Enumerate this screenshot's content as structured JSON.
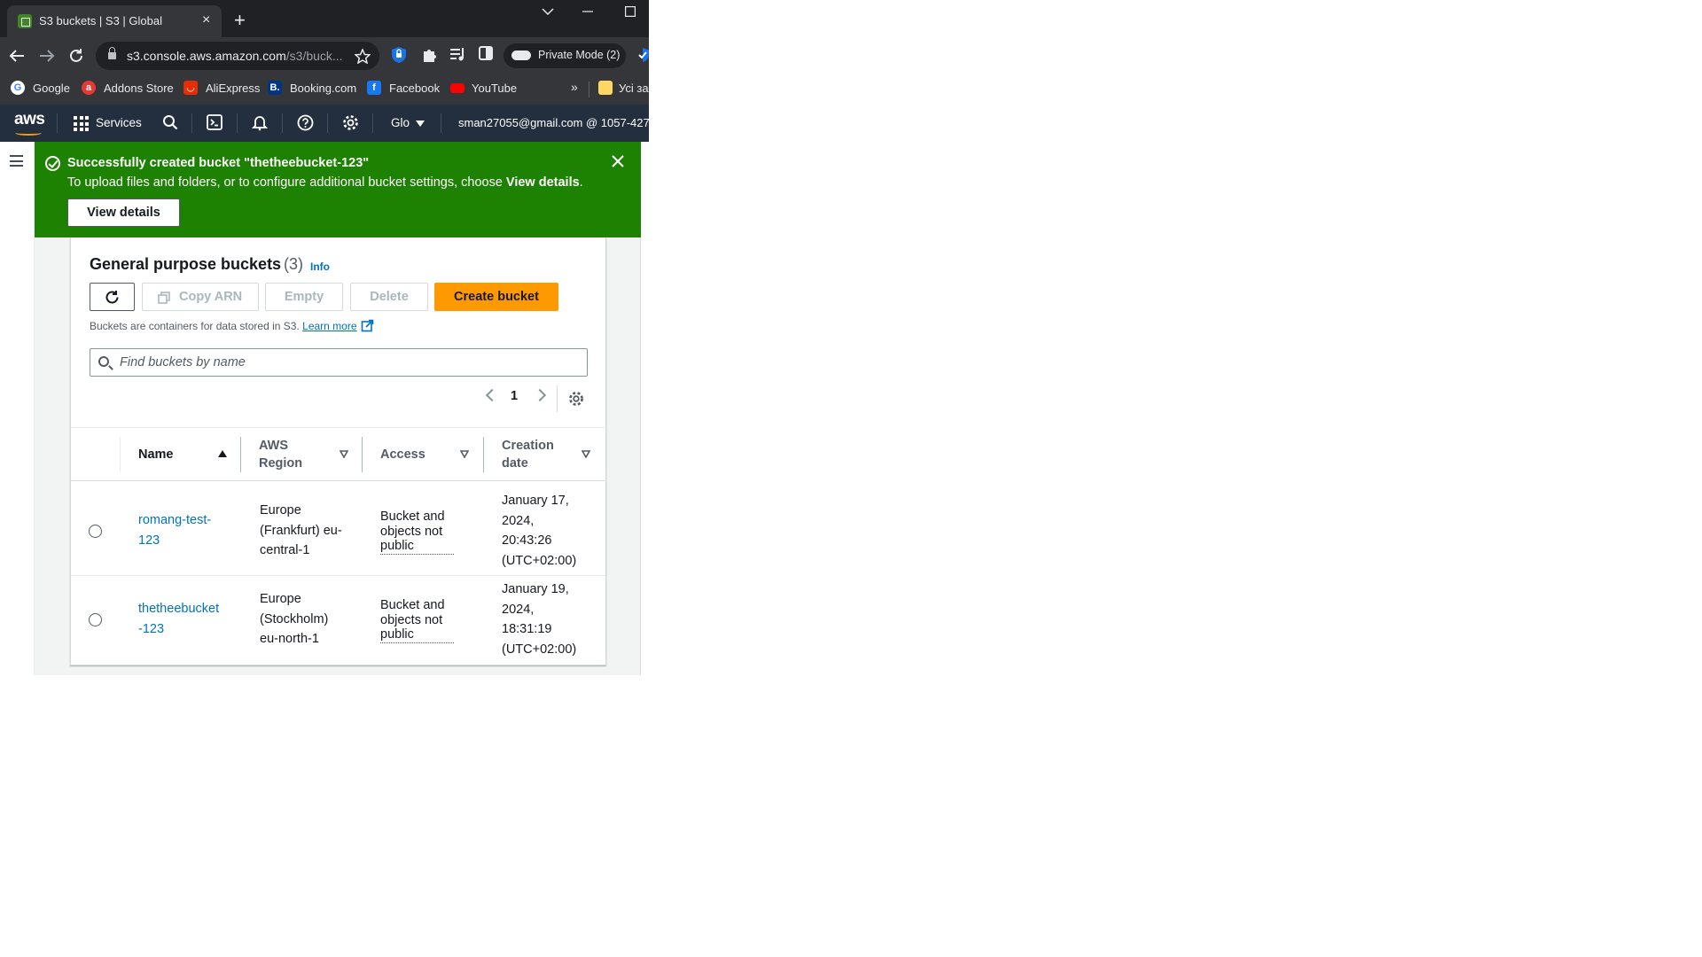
{
  "browser": {
    "tab_title": "S3 buckets | S3 | Global",
    "tab_close": "×",
    "new_tab": "+",
    "url_host": "s3.console.aws.amazon.com",
    "url_path": "/s3/buck...",
    "private_mode_label": "Private Mode (2)",
    "bookmarks": [
      "Google",
      "Addons Store",
      "AliExpress",
      "Booking.com",
      "Facebook",
      "YouTube"
    ],
    "bookmarks_overflow": "»",
    "bookmarks_folder": "Усі зак"
  },
  "aws_nav": {
    "logo": "aws",
    "services_label": "Services",
    "region_label": "Glo",
    "account_label": "sman27055@gmail.com @ 1057-427"
  },
  "flash": {
    "title": "Successfully created bucket \"thetheebucket-123\"",
    "text_prefix": "To upload files and folders, or to configure additional bucket settings, choose ",
    "text_bold": "View details",
    "text_suffix": ".",
    "button_label": "View details",
    "color": "#1d8102"
  },
  "panel": {
    "title": "General purpose buckets",
    "count": "(3)",
    "info_link": "Info",
    "buttons": {
      "copy_arn": "Copy ARN",
      "empty": "Empty",
      "delete": "Delete",
      "create": "Create bucket"
    },
    "description": "Buckets are containers for data stored in S3.",
    "learn_more": "Learn more",
    "search_placeholder": "Find buckets by name",
    "page_number": "1",
    "accent_color": "#ff9900"
  },
  "table": {
    "columns": {
      "name": "Name",
      "region_line1": "AWS",
      "region_line2": "Region",
      "access": "Access",
      "date_line1": "Creation",
      "date_line2": "date"
    },
    "rows": [
      {
        "name_line1": "romang-test-",
        "name_line2": "123",
        "region_line1": "Europe",
        "region_line2": "(Frankfurt) eu-",
        "region_line3": "central-1",
        "access_line1": "Bucket and",
        "access_line2": "objects not",
        "access_line3": "public",
        "date_line1": "January 17,",
        "date_line2": "2024,",
        "date_line3": "20:43:26",
        "date_line4": "(UTC+02:00)"
      },
      {
        "name_line1": "thetheebucket",
        "name_line2": "-123",
        "region_line1": "Europe",
        "region_line2": "(Stockholm)",
        "region_line3": "eu-north-1",
        "access_line1": "Bucket and",
        "access_line2": "objects not",
        "access_line3": "public",
        "date_line1": "January 19,",
        "date_line2": "2024,",
        "date_line3": "18:31:19",
        "date_line4": "(UTC+02:00)"
      }
    ]
  }
}
